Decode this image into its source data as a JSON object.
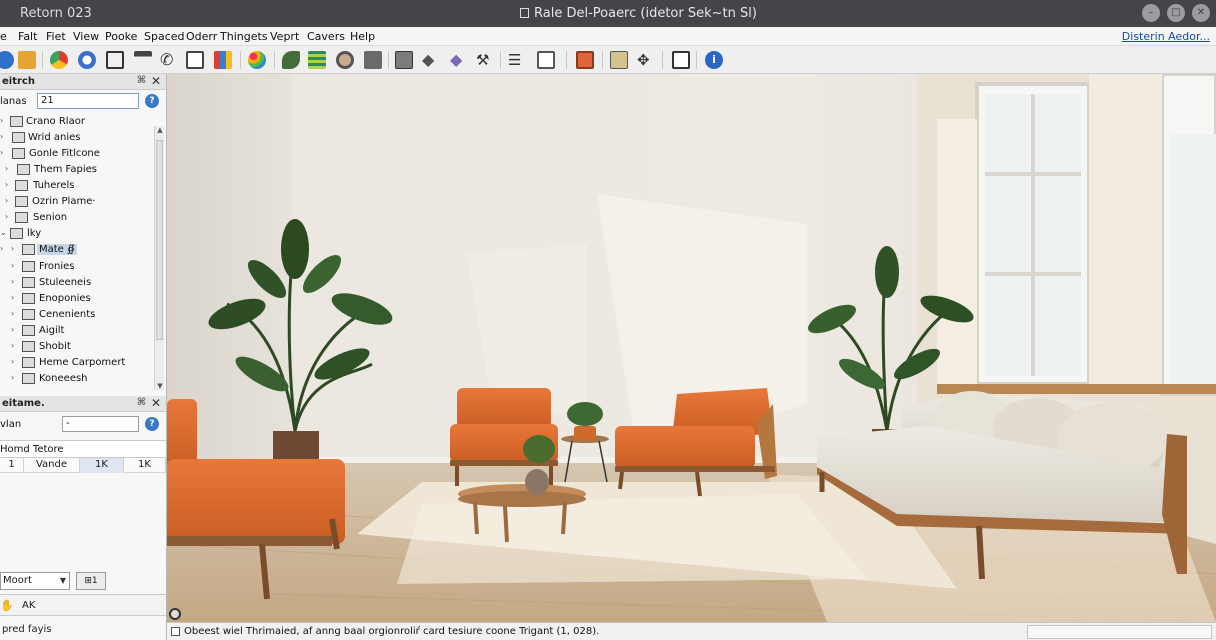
{
  "window": {
    "app_title": "Retorn 023",
    "title": "Rale Del-Poaerc (idetor Sek~tn Sl)",
    "buttons": [
      "minimize",
      "maximize",
      "close"
    ]
  },
  "menu": {
    "items": [
      "e",
      "Falt",
      "Fiet",
      "View",
      "Pooke",
      "Spaced",
      "Oderr",
      "Thingets",
      "Veprt",
      "Cavers",
      "Help"
    ],
    "right_link": "Disterin Aedor..."
  },
  "toolbar": {
    "icons": [
      "globe-icon",
      "folder-icon",
      "browser-icon",
      "lock-icon",
      "stamp-icon",
      "phone-icon",
      "mail-icon",
      "chart-icon",
      "palette-icon",
      "leaf-icon",
      "layers-icon",
      "target-icon",
      "cube-icon",
      "box-icon",
      "diamond-icon",
      "gem-icon",
      "tools-icon",
      "list-icon",
      "image-icon",
      "screen-icon",
      "camera-icon",
      "move-icon",
      "frame-icon",
      "help-icon"
    ]
  },
  "left_panel": {
    "header": "eitrch",
    "search_label": "lanas",
    "search_value": "21",
    "tree": [
      {
        "label": "Crano Rlaor",
        "depth": 0
      },
      {
        "label": "Wrid anies",
        "depth": 0
      },
      {
        "label": "Gonle Fitlcone",
        "depth": 0
      },
      {
        "label": "Them Fapies",
        "depth": 1
      },
      {
        "label": "Tuherels",
        "depth": 0
      },
      {
        "label": "Ozrin Plame·",
        "depth": 0
      },
      {
        "label": "Senion",
        "depth": 0
      },
      {
        "label": "lky",
        "depth": 0
      },
      {
        "label": "Mate ∯",
        "depth": 1,
        "selected": true
      },
      {
        "label": "Fronies",
        "depth": 1
      },
      {
        "label": "Stuleeneis",
        "depth": 1
      },
      {
        "label": "Enoponies",
        "depth": 1
      },
      {
        "label": "Cenenients",
        "depth": 1
      },
      {
        "label": "Aigilt",
        "depth": 1
      },
      {
        "label": "Shobit",
        "depth": 1
      },
      {
        "label": "Heme Carpomert",
        "depth": 1
      },
      {
        "label": "Koneeesh",
        "depth": 1
      }
    ],
    "properties_header": "eitame.",
    "prop_label": "vlan",
    "prop_value": "-",
    "table_title": "Homd Tetore",
    "table_headers": [
      "",
      "",
      "",
      ""
    ],
    "table_row": [
      "1",
      "Vande",
      "1K",
      "1K"
    ],
    "dropdown_value": "Moort",
    "small_button": "⊞1",
    "footer_label": "AK",
    "status": "pred fayis"
  },
  "statusbar": {
    "text": "Obeest wiel Thrimaied, af anng baal orgionroliŕ card tesiure coone Trigant (1, 028)."
  },
  "colors": {
    "title_bg": "#434549",
    "accent": "#3b78c8",
    "selection": "#c6d5e8"
  }
}
